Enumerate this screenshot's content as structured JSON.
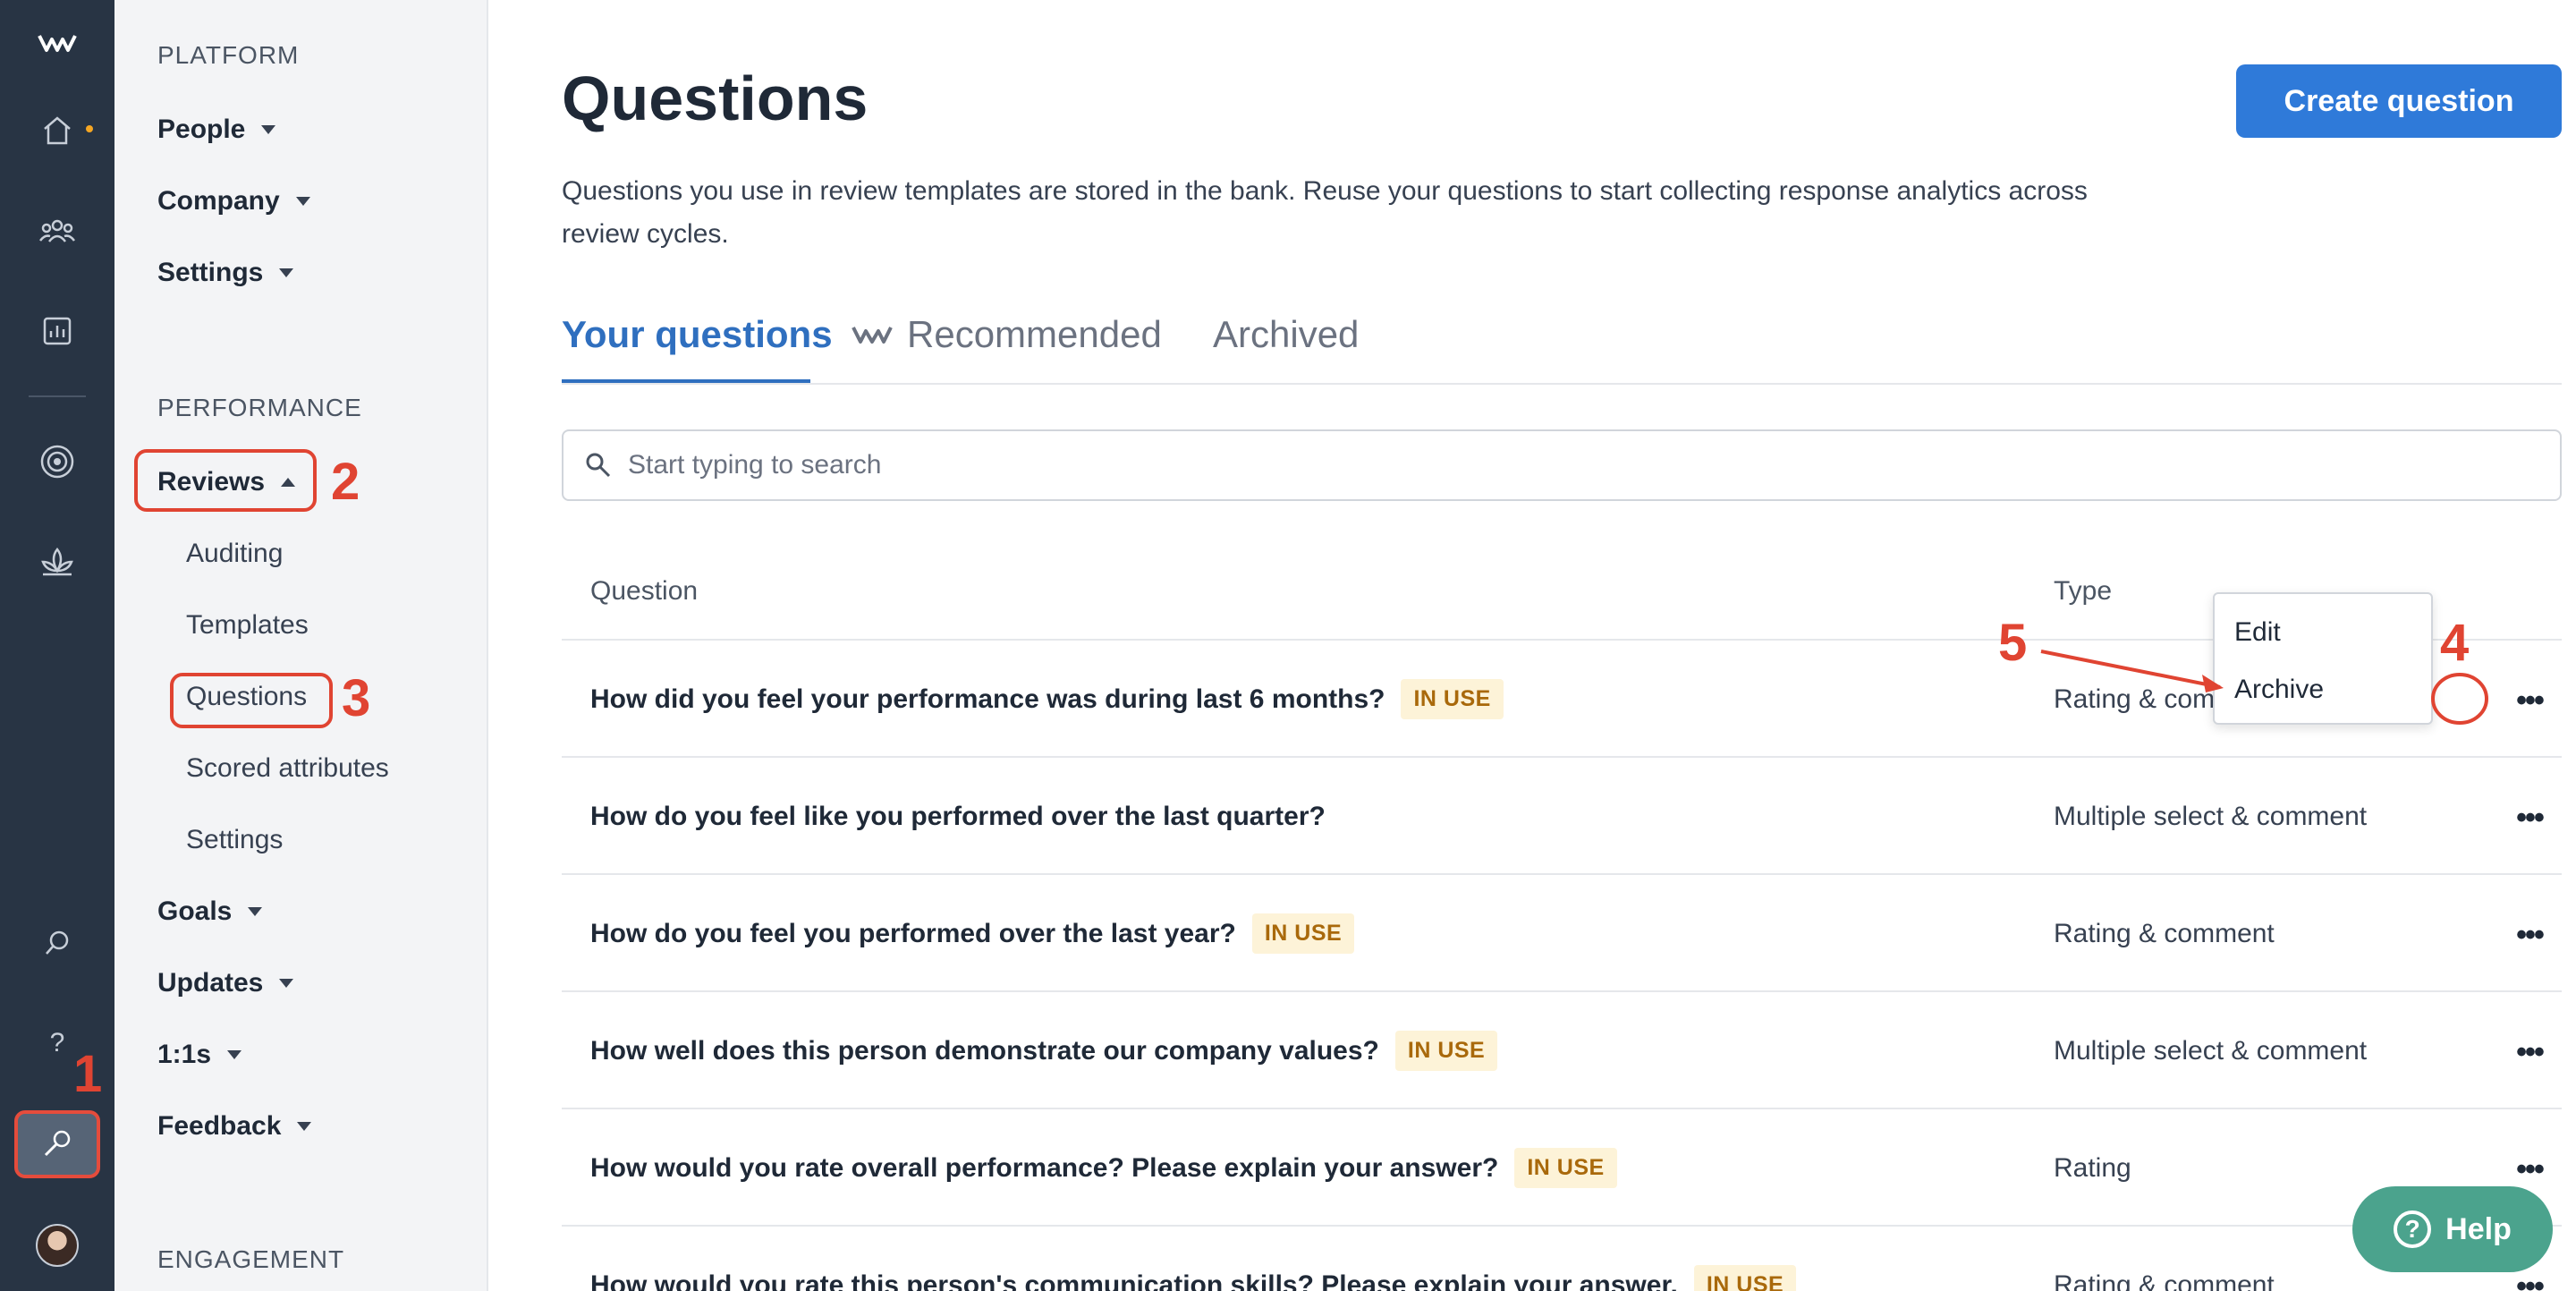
{
  "rail": {
    "items": [
      {
        "name": "logo-icon"
      },
      {
        "name": "home-icon"
      },
      {
        "name": "people-icon"
      },
      {
        "name": "analytics-icon"
      },
      {
        "name": "target-icon"
      },
      {
        "name": "lotus-icon"
      },
      {
        "name": "search-icon"
      },
      {
        "name": "help-question-icon",
        "glyph": "?"
      },
      {
        "name": "wrench-icon"
      },
      {
        "name": "avatar"
      }
    ],
    "annotation": "1"
  },
  "nav": {
    "platform_label": "PLATFORM",
    "platform_items": [
      "People",
      "Company",
      "Settings"
    ],
    "performance_label": "PERFORMANCE",
    "reviews_label": "Reviews",
    "reviews_annotation": "2",
    "reviews_sub": [
      "Auditing",
      "Templates",
      "Questions",
      "Scored attributes",
      "Settings"
    ],
    "questions_annotation": "3",
    "performance_items": [
      "Goals",
      "Updates",
      "1:1s",
      "Feedback"
    ],
    "engagement_label": "ENGAGEMENT"
  },
  "page": {
    "title": "Questions",
    "create_button": "Create question",
    "description": "Questions you use in review templates are stored in the bank. Reuse your questions to start collecting response analytics across review cycles."
  },
  "tabs": [
    {
      "label": "Your questions",
      "active": true
    },
    {
      "label": "Recommended",
      "active": false
    },
    {
      "label": "Archived",
      "active": false
    }
  ],
  "search": {
    "placeholder": "Start typing to search"
  },
  "table": {
    "columns": [
      "Question",
      "Type"
    ],
    "rows": [
      {
        "question": "How did you feel your performance was during last 6 months?",
        "badge": "IN USE",
        "type": "Rating & comment"
      },
      {
        "question": "How do you feel like you performed over the last quarter?",
        "badge": "",
        "type": "Multiple select & comment"
      },
      {
        "question": "How do you feel you performed over the last year?",
        "badge": "IN USE",
        "type": "Rating & comment"
      },
      {
        "question": "How well does this person demonstrate our company values?",
        "badge": "IN USE",
        "type": "Multiple select & comment"
      },
      {
        "question": "How would you rate overall performance? Please explain your answer?",
        "badge": "IN USE",
        "type": "Rating"
      },
      {
        "question": "How would you rate this person's communication skills? Please explain your answer.",
        "badge": "IN USE",
        "type": "Rating & comment"
      }
    ],
    "more_glyph": "•••"
  },
  "dropdown": {
    "items": [
      "Edit",
      "Archive"
    ]
  },
  "annotations": {
    "dots": "4",
    "archive": "5"
  },
  "help": {
    "label": "Help",
    "glyph": "?"
  },
  "colors": {
    "accent": "#2f7ad9",
    "annotation": "#e04432",
    "rail": "#283444",
    "badge_bg": "#fdf3d8",
    "badge_text": "#a9690b",
    "help": "#4ba38d"
  }
}
